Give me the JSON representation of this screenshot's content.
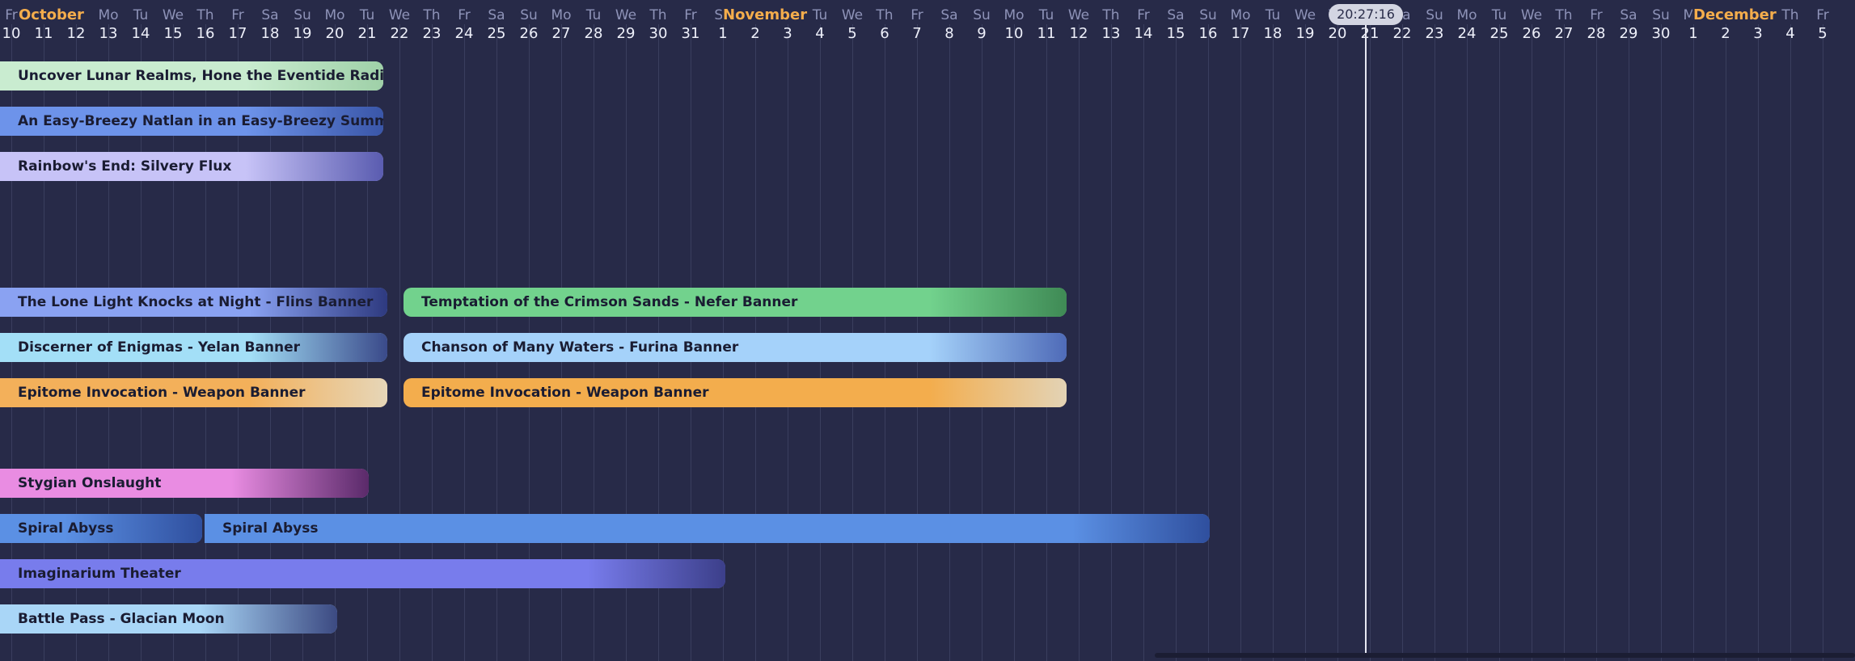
{
  "timeline": {
    "now_time": "20:27:16",
    "months": [
      {
        "label": "October",
        "day_index": 0
      },
      {
        "label": "November",
        "day_index": 22
      },
      {
        "label": "December",
        "day_index": 52
      }
    ],
    "days": [
      {
        "wd": "Fr",
        "d": "10"
      },
      {
        "wd": "Sa",
        "d": "11"
      },
      {
        "wd": "Su",
        "d": "12"
      },
      {
        "wd": "Mo",
        "d": "13"
      },
      {
        "wd": "Tu",
        "d": "14"
      },
      {
        "wd": "We",
        "d": "15"
      },
      {
        "wd": "Th",
        "d": "16"
      },
      {
        "wd": "Fr",
        "d": "17"
      },
      {
        "wd": "Sa",
        "d": "18"
      },
      {
        "wd": "Su",
        "d": "19"
      },
      {
        "wd": "Mo",
        "d": "20"
      },
      {
        "wd": "Tu",
        "d": "21"
      },
      {
        "wd": "We",
        "d": "22"
      },
      {
        "wd": "Th",
        "d": "23"
      },
      {
        "wd": "Fr",
        "d": "24"
      },
      {
        "wd": "Sa",
        "d": "25"
      },
      {
        "wd": "Su",
        "d": "26"
      },
      {
        "wd": "Mo",
        "d": "27"
      },
      {
        "wd": "Tu",
        "d": "28"
      },
      {
        "wd": "We",
        "d": "29"
      },
      {
        "wd": "Th",
        "d": "30"
      },
      {
        "wd": "Fr",
        "d": "31"
      },
      {
        "wd": "Sa",
        "d": "1"
      },
      {
        "wd": "Su",
        "d": "2"
      },
      {
        "wd": "Mo",
        "d": "3"
      },
      {
        "wd": "Tu",
        "d": "4"
      },
      {
        "wd": "We",
        "d": "5"
      },
      {
        "wd": "Th",
        "d": "6"
      },
      {
        "wd": "Fr",
        "d": "7"
      },
      {
        "wd": "Sa",
        "d": "8"
      },
      {
        "wd": "Su",
        "d": "9"
      },
      {
        "wd": "Mo",
        "d": "10"
      },
      {
        "wd": "Tu",
        "d": "11"
      },
      {
        "wd": "We",
        "d": "12"
      },
      {
        "wd": "Th",
        "d": "13"
      },
      {
        "wd": "Fr",
        "d": "14"
      },
      {
        "wd": "Sa",
        "d": "15"
      },
      {
        "wd": "Su",
        "d": "16"
      },
      {
        "wd": "Mo",
        "d": "17"
      },
      {
        "wd": "Tu",
        "d": "18"
      },
      {
        "wd": "We",
        "d": "19"
      },
      {
        "wd": "Th",
        "d": "20"
      },
      {
        "wd": "Fr",
        "d": "21"
      },
      {
        "wd": "Sa",
        "d": "22"
      },
      {
        "wd": "Su",
        "d": "23"
      },
      {
        "wd": "Mo",
        "d": "24"
      },
      {
        "wd": "Tu",
        "d": "25"
      },
      {
        "wd": "We",
        "d": "26"
      },
      {
        "wd": "Th",
        "d": "27"
      },
      {
        "wd": "Fr",
        "d": "28"
      },
      {
        "wd": "Sa",
        "d": "29"
      },
      {
        "wd": "Su",
        "d": "30"
      },
      {
        "wd": "Mo",
        "d": "1"
      },
      {
        "wd": "Tu",
        "d": "2"
      },
      {
        "wd": "We",
        "d": "3"
      },
      {
        "wd": "Th",
        "d": "4"
      },
      {
        "wd": "Fr",
        "d": "5"
      }
    ],
    "events": [
      {
        "name": "Uncover Lunar Realms, Hone the Eventide Radiance",
        "color": "#c9ecd0",
        "art": "#9fd0a8"
      },
      {
        "name": "An Easy-Breezy Natlan in an Easy-Breezy Summer!",
        "color": "#6d93ea",
        "art": "#3a56a8"
      },
      {
        "name": "Rainbow's End: Silvery Flux",
        "color": "#c7c3f7",
        "art": "#5a5cb0"
      },
      {
        "name": "The Lone Light Knocks at Night - Flins Banner",
        "color": "#8aa2f2",
        "art": "#2e3a80"
      },
      {
        "name": "Temptation of the Crimson Sands - Nefer Banner",
        "color": "#72d28d",
        "art": "#3f8a55"
      },
      {
        "name": "Discerner of Enigmas - Yelan Banner",
        "color": "#a3dff7",
        "art": "#3a4a8a"
      },
      {
        "name": "Chanson of Many Waters - Furina Banner",
        "color": "#a5d2fa",
        "art": "#4f6bb8"
      },
      {
        "name": "Epitome Invocation - Weapon Banner",
        "color": "#f3b05a",
        "art": "#e6d6b8"
      },
      {
        "name": "Epitome Invocation - Weapon Banner",
        "color": "#f3ad4d",
        "art": "#e3d3b5"
      },
      {
        "name": "Stygian Onslaught",
        "color": "#e98ce2",
        "art": "#5a2a6a"
      },
      {
        "name": "Spiral Abyss",
        "color": "#5b90e4",
        "art": "#2f4f9e"
      },
      {
        "name": "Spiral Abyss",
        "color": "#5b90e4",
        "art": "#2f4f9e"
      },
      {
        "name": "Imaginarium Theater",
        "color": "#787cec",
        "art": "#3c3f8a"
      },
      {
        "name": "Battle Pass - Glacian Moon",
        "color": "#a9d6f7",
        "art": "#3c4a82"
      }
    ]
  }
}
